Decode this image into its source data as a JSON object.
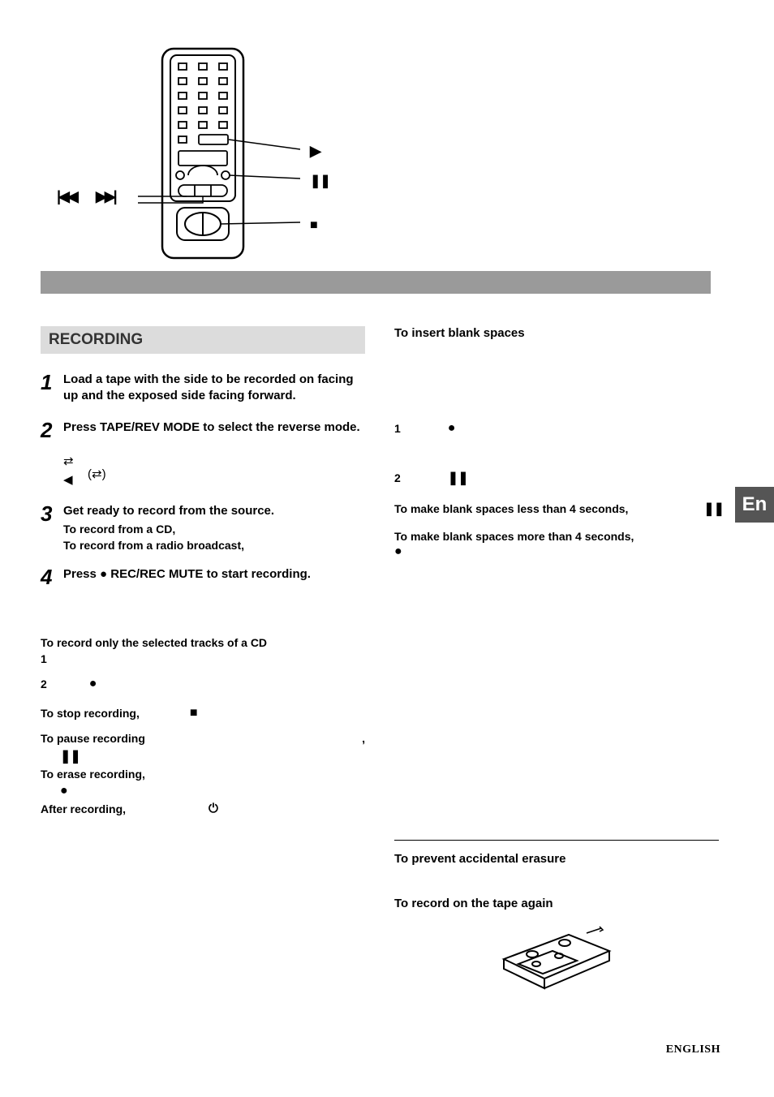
{
  "section": {
    "heading": "RECORDING"
  },
  "steps": {
    "s1": {
      "num": "1",
      "text": "Load a tape with the side to be recorded on facing up and the exposed side facing forward."
    },
    "s2": {
      "num": "2",
      "text": "Press TAPE/REV MODE to select the reverse mode."
    },
    "s3": {
      "num": "3",
      "text": "Get ready to record from the source.",
      "sub1": "To record from a CD,",
      "sub2": "To record from a radio broadcast,"
    },
    "s4": {
      "num": "4",
      "text": "Press ● REC/REC MUTE to start recording."
    }
  },
  "left_extra": {
    "l1": "To record only the selected tracks of a CD",
    "l1a": "1",
    "l2a": "2",
    "l3": "To stop recording,",
    "l4": "To pause recording",
    "l4comma": ",",
    "l5": "To erase recording,",
    "l6": "After recording,"
  },
  "right": {
    "r1": "To insert blank spaces",
    "r1a": "1",
    "r1b": "2",
    "r2": "To make blank spaces less than 4 seconds,",
    "r3": "To make blank spaces more than 4 seconds,",
    "r4": "To prevent accidental erasure",
    "r5": "To record on the tape again"
  },
  "lang_tab": "En",
  "footer_lang": "ENGLISH",
  "icons": {
    "play": "▶",
    "pause": "❚❚",
    "stop": "■",
    "rec": "●",
    "prev": "|◀◀",
    "next": "▶▶|",
    "power": "⏻",
    "rev1": "⇄",
    "rev2": "(⇄)",
    "rev3": "◀"
  }
}
